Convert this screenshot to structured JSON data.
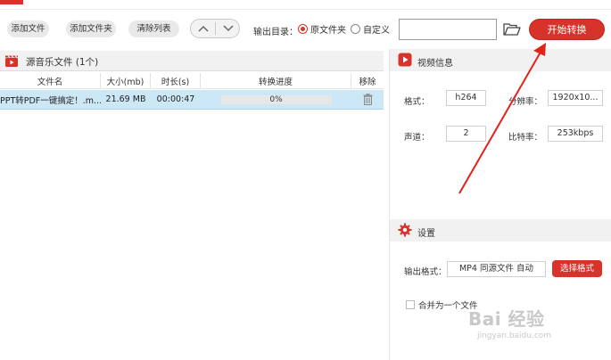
{
  "toolbar": {
    "add_file": "添加文件",
    "add_folder": "添加文件夹",
    "clear_list": "清除列表",
    "output_dir_label": "输出目录：",
    "radio_source_folder": "原文件夹",
    "radio_custom": "自定义",
    "path_value": "",
    "start_button": "开始转换",
    "icons": {
      "up": "chevron-up-icon",
      "down": "chevron-down-icon",
      "folder": "folder-open-icon"
    }
  },
  "file_list": {
    "title": "源音乐文件 (1个)",
    "icon": "video-clapper-icon",
    "columns": [
      "文件名",
      "大小(mb)",
      "时长(s)",
      "转换进度",
      "移除"
    ],
    "rows": [
      {
        "name": "PPT转PDF一键搞定！.m...",
        "size": "21.69 MB",
        "duration": "00:00:47",
        "progress": "0%",
        "progress_value": 0,
        "remove_icon": "trash-icon"
      }
    ]
  },
  "video_info": {
    "title": "视频信息",
    "icon": "play-icon",
    "format_label": "格式：",
    "format_value": "h264",
    "resolution_label": "分辨率：",
    "resolution_value": "1920x10...",
    "channels_label": "声道：",
    "channels_value": "2",
    "bitrate_label": "比特率：",
    "bitrate_value": "253kbps"
  },
  "settings": {
    "title": "设置",
    "icon": "gear-icon",
    "output_format_label": "输出格式：",
    "output_format_value": "MP4 同源文件 自动",
    "select_format_button": "选择格式",
    "merge_label": "合并为一个文件",
    "merge_checked": false
  },
  "watermark": {
    "text": "Bai 经验",
    "url": "jingyan.baidu.com"
  },
  "colors": {
    "accent": "#d8332a",
    "selected_row": "#cce8f6",
    "panel_header": "#f1f1f1"
  }
}
